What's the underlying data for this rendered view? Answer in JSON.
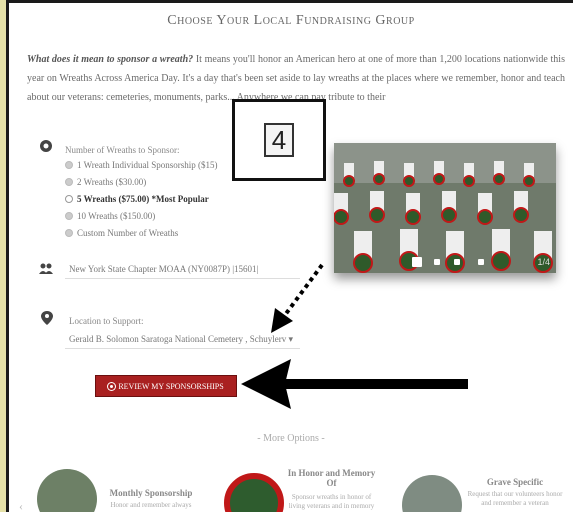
{
  "heading": "Choose Your Local Fundraising Group",
  "intro": {
    "lead": "What does it mean to sponsor a wreath?",
    "body": "It means you'll honor an American hero at one of more than 1,200 locations nationwide this year on Wreaths Across America Day. It's a day that's been set aside to lay wreaths at the places where we remember, honor and teach about our veterans: cemeteries, monuments, parks... Anywhere we can pay tribute to their"
  },
  "wreaths": {
    "label": "Number of Wreaths to Sponsor:",
    "options": [
      "1 Wreath Individual Sponsorship ($15)",
      "2 Wreaths ($30.00)",
      "5 Wreaths ($75.00) *Most Popular",
      "10 Wreaths ($150.00)",
      "Custom Number of Wreaths"
    ],
    "selected_index": 2
  },
  "group": {
    "value": "New York State Chapter MOAA (NY0087P) |15601|"
  },
  "location": {
    "label": "Location to Support:",
    "value": "Gerald B. Solomon Saratoga National Cemetery , Schuylerv"
  },
  "review_button": "REVIEW MY SPONSORSHIPS",
  "more_options": "- More Options -",
  "slider": {
    "counter": "1/4",
    "total": 4,
    "active": 1
  },
  "annotation": {
    "number": "4"
  },
  "cards": [
    {
      "title": "Monthly Sponsorship",
      "text": "Honor and remember always"
    },
    {
      "title": "In Honor and Memory Of",
      "text": "Sponsor wreaths in honor of living veterans and in memory"
    },
    {
      "title": "Grave Specific",
      "text": "Request that our volunteers honor and remember a veteran"
    }
  ],
  "colors": {
    "button": "#a92020",
    "page_bg": "#e5e1a8",
    "arrow": "#000000"
  }
}
